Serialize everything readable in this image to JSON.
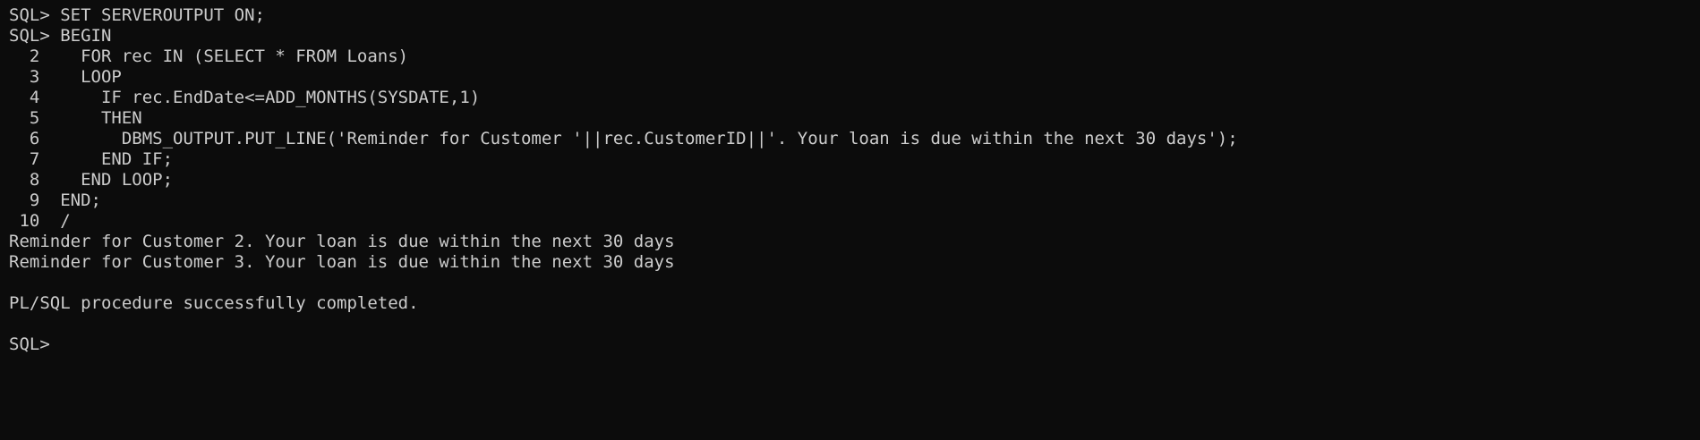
{
  "terminal": {
    "lines": [
      "SQL> SET SERVEROUTPUT ON;",
      "SQL> BEGIN",
      "  2    FOR rec IN (SELECT * FROM Loans)",
      "  3    LOOP",
      "  4      IF rec.EndDate<=ADD_MONTHS(SYSDATE,1)",
      "  5      THEN",
      "  6        DBMS_OUTPUT.PUT_LINE('Reminder for Customer '||rec.CustomerID||'. Your loan is due within the next 30 days');",
      "  7      END IF;",
      "  8    END LOOP;",
      "  9  END;",
      " 10  /",
      "Reminder for Customer 2. Your loan is due within the next 30 days",
      "Reminder for Customer 3. Your loan is due within the next 30 days",
      "",
      "PL/SQL procedure successfully completed.",
      "",
      "SQL>"
    ]
  }
}
